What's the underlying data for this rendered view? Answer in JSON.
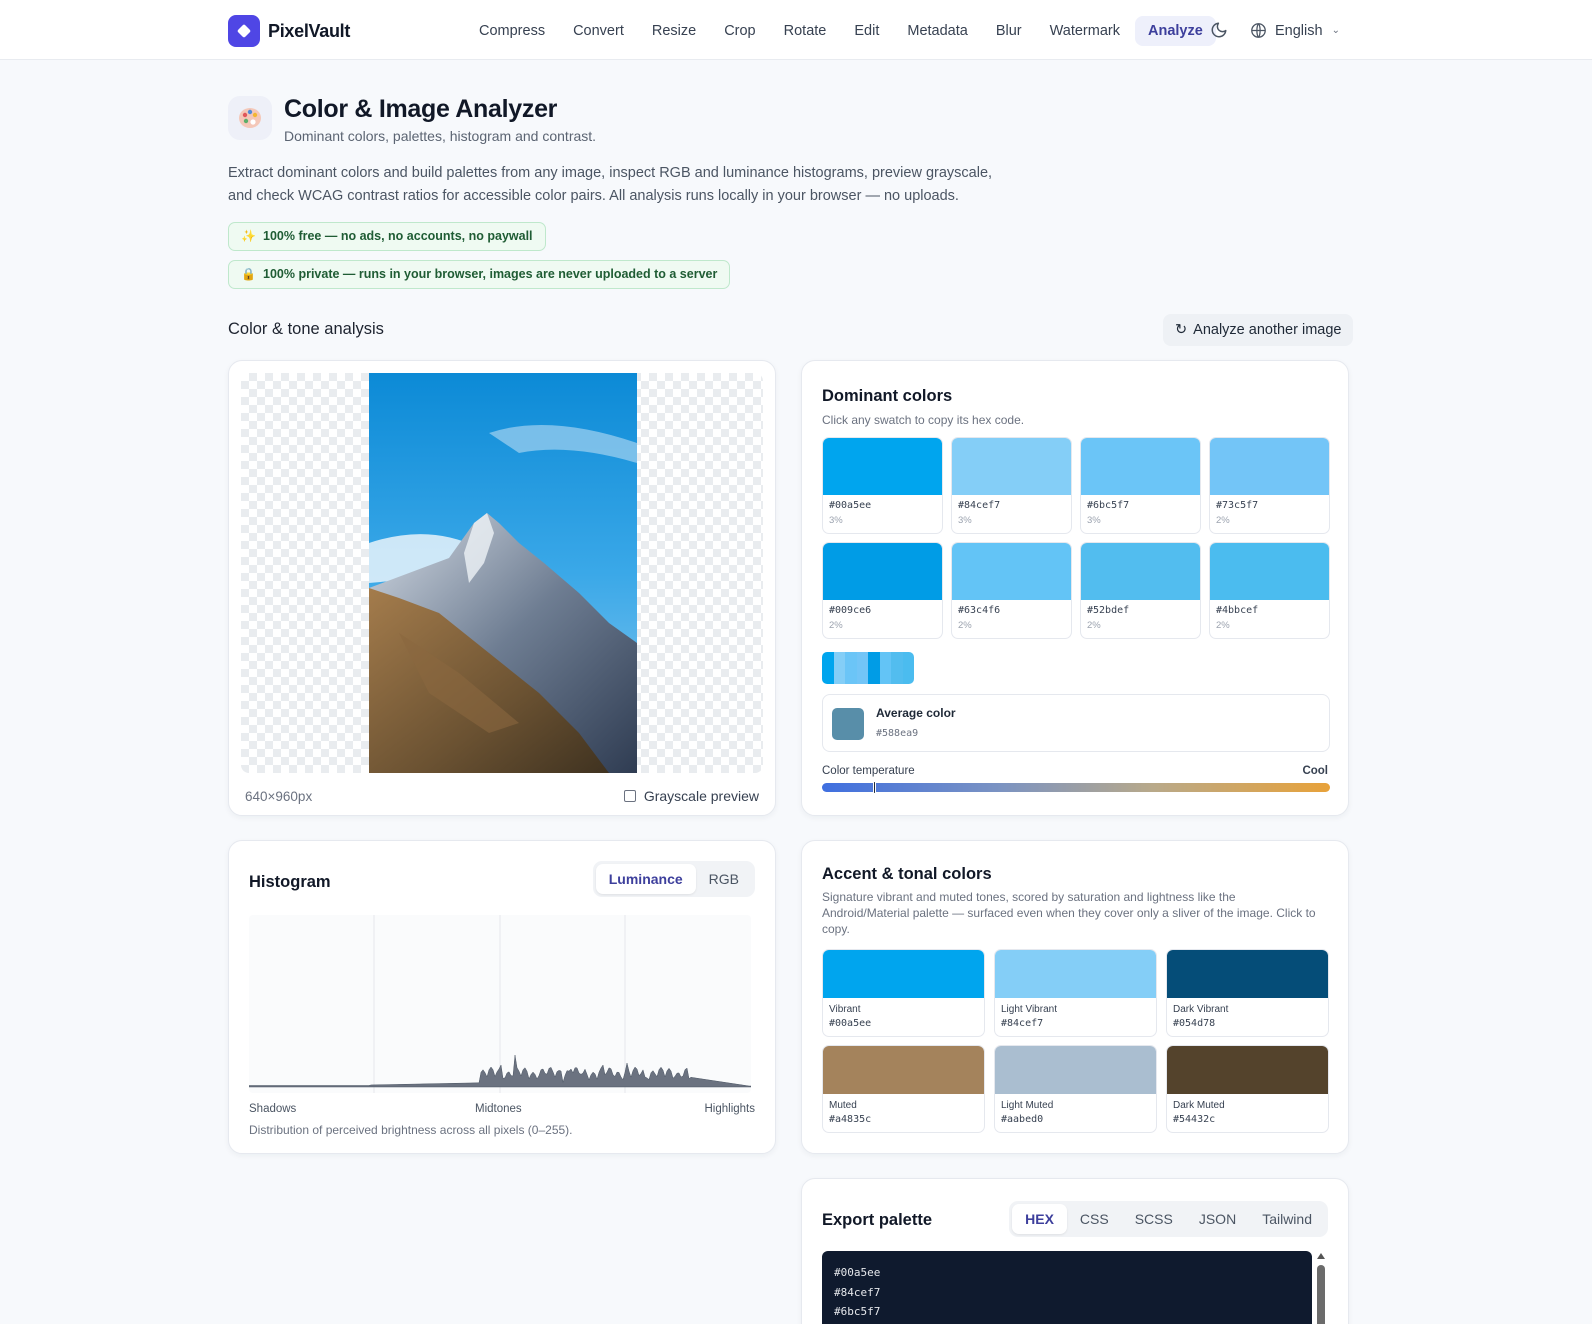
{
  "nav": {
    "brand": "PixelVault",
    "links": [
      "Compress",
      "Convert",
      "Resize",
      "Crop",
      "Rotate",
      "Edit",
      "Metadata",
      "Blur",
      "Watermark",
      "Analyze"
    ],
    "active": "Analyze",
    "language": "English"
  },
  "hero": {
    "title": "Color & Image Analyzer",
    "subtitle": "Dominant colors, palettes, histogram and contrast.",
    "description": "Extract dominant colors and build palettes from any image, inspect RGB and luminance histograms, preview grayscale, and check WCAG contrast ratios for accessible color pairs. All analysis runs locally in your browser — no uploads.",
    "pills": [
      "100% free — no ads, no accounts, no paywall",
      "100% private — runs in your browser, images are never uploaded to a server"
    ]
  },
  "section": {
    "title": "Color & tone analysis",
    "analyze_again": "Analyze another image"
  },
  "image_card": {
    "dimensions": "640×960px",
    "grayscale_label": "Grayscale preview",
    "grayscale_checked": false
  },
  "dominant": {
    "title": "Dominant colors",
    "subtitle": "Click any swatch to copy its hex code.",
    "swatches": [
      {
        "hex": "#00a5ee",
        "pct": "3%"
      },
      {
        "hex": "#84cef7",
        "pct": "3%"
      },
      {
        "hex": "#6bc5f7",
        "pct": "3%"
      },
      {
        "hex": "#73c5f7",
        "pct": "2%"
      },
      {
        "hex": "#009ce6",
        "pct": "2%"
      },
      {
        "hex": "#63c4f6",
        "pct": "2%"
      },
      {
        "hex": "#52bdef",
        "pct": "2%"
      },
      {
        "hex": "#4bbcef",
        "pct": "2%"
      }
    ],
    "average_label": "Average color",
    "average_hex": "#588ea9",
    "temp_label": "Color temperature",
    "temp_value": "Cool",
    "temp_position": 0.1
  },
  "histogram": {
    "title": "Histogram",
    "tabs": [
      "Luminance",
      "RGB"
    ],
    "active_tab": "Luminance",
    "labels": {
      "left": "Shadows",
      "mid": "Midtones",
      "right": "Highlights"
    },
    "caption": "Distribution of perceived brightness across all pixels (0–255)."
  },
  "accent": {
    "title": "Accent & tonal colors",
    "subtitle": "Signature vibrant and muted tones, scored by saturation and lightness like the Android/Material palette — surfaced even when they cover only a sliver of the image. Click to copy.",
    "items": [
      {
        "name": "Vibrant",
        "hex": "#00a5ee"
      },
      {
        "name": "Light Vibrant",
        "hex": "#84cef7"
      },
      {
        "name": "Dark Vibrant",
        "hex": "#054d78"
      },
      {
        "name": "Muted",
        "hex": "#a4835c"
      },
      {
        "name": "Light Muted",
        "hex": "#aabed0"
      },
      {
        "name": "Dark Muted",
        "hex": "#54432c"
      }
    ]
  },
  "export": {
    "title": "Export palette",
    "tabs": [
      "HEX",
      "CSS",
      "SCSS",
      "JSON",
      "Tailwind"
    ],
    "active_tab": "HEX",
    "lines": [
      "#00a5ee",
      "#84cef7",
      "#6bc5f7"
    ]
  }
}
